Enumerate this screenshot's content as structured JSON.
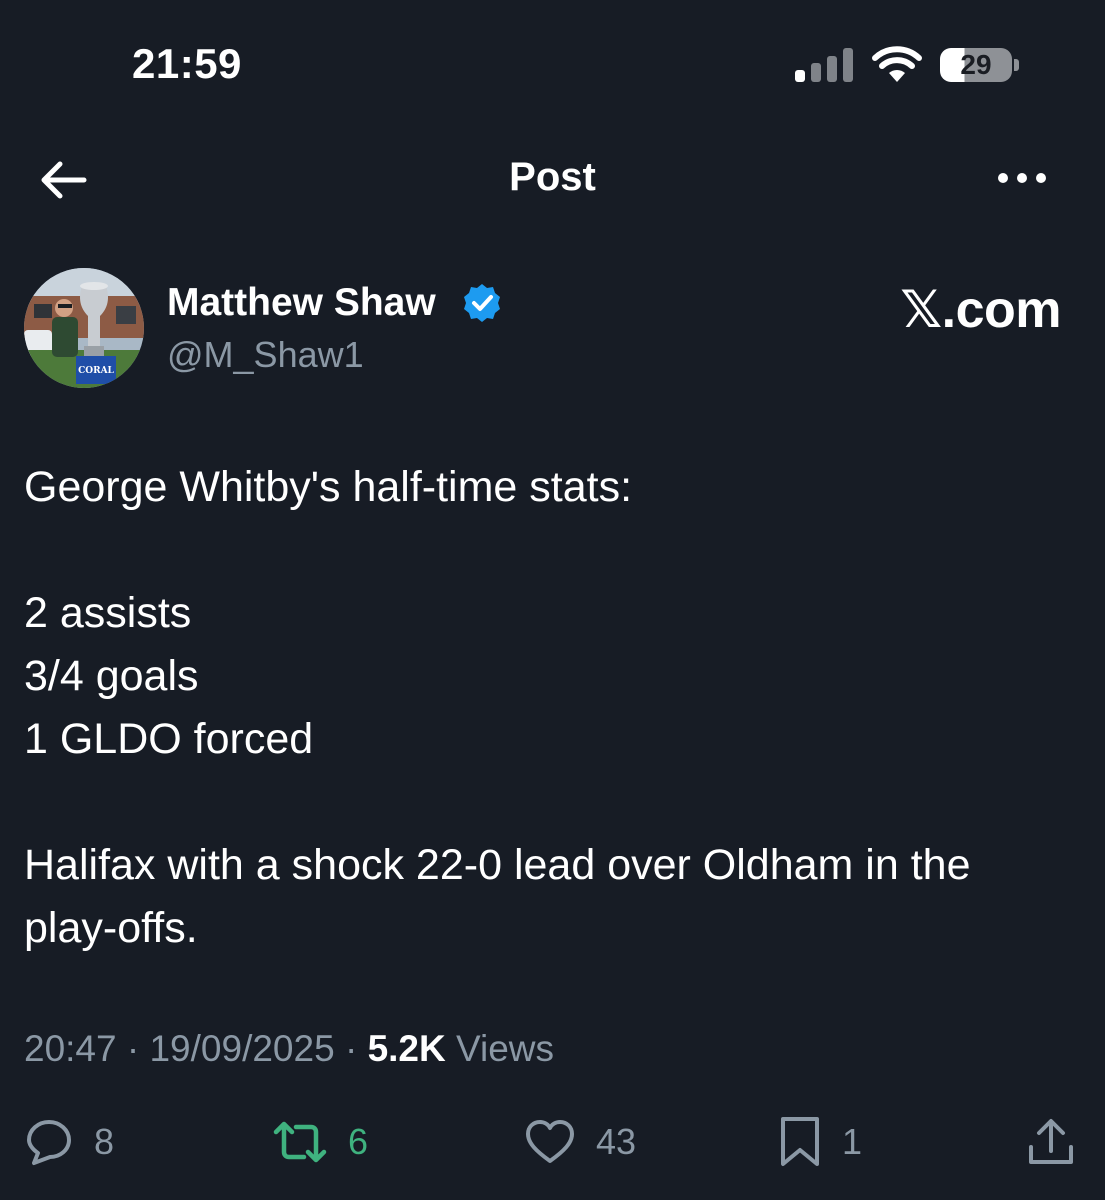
{
  "status_bar": {
    "time": "21:59",
    "battery_level": "29"
  },
  "header": {
    "title": "Post",
    "back_icon": "arrow-left-icon",
    "more_icon": "more-horizontal-icon"
  },
  "post": {
    "author_name": "Matthew Shaw",
    "author_handle": "@M_Shaw1",
    "verified": true,
    "brand": "𝕏.com",
    "avatar_caption": "CORAL",
    "body": {
      "line1": "George Whitby's half-time stats:",
      "line2": "2 assists",
      "line3": "3/4 goals",
      "line4": "1 GLDO forced",
      "line5": "Halifax with a shock 22-0 lead over Oldham in the play-offs."
    },
    "meta": {
      "time": "20:47",
      "date": "19/09/2025",
      "views_count": "5.2K",
      "views_label": "Views",
      "separator": "·"
    }
  },
  "actions": {
    "replies": "8",
    "reposts": "6",
    "likes": "43",
    "bookmarks": "1"
  },
  "colors": {
    "background": "#171c25",
    "text": "#ffffff",
    "secondary": "#8b98a5",
    "verified": "#1d9bf0",
    "repost_active": "#3fb27f"
  }
}
